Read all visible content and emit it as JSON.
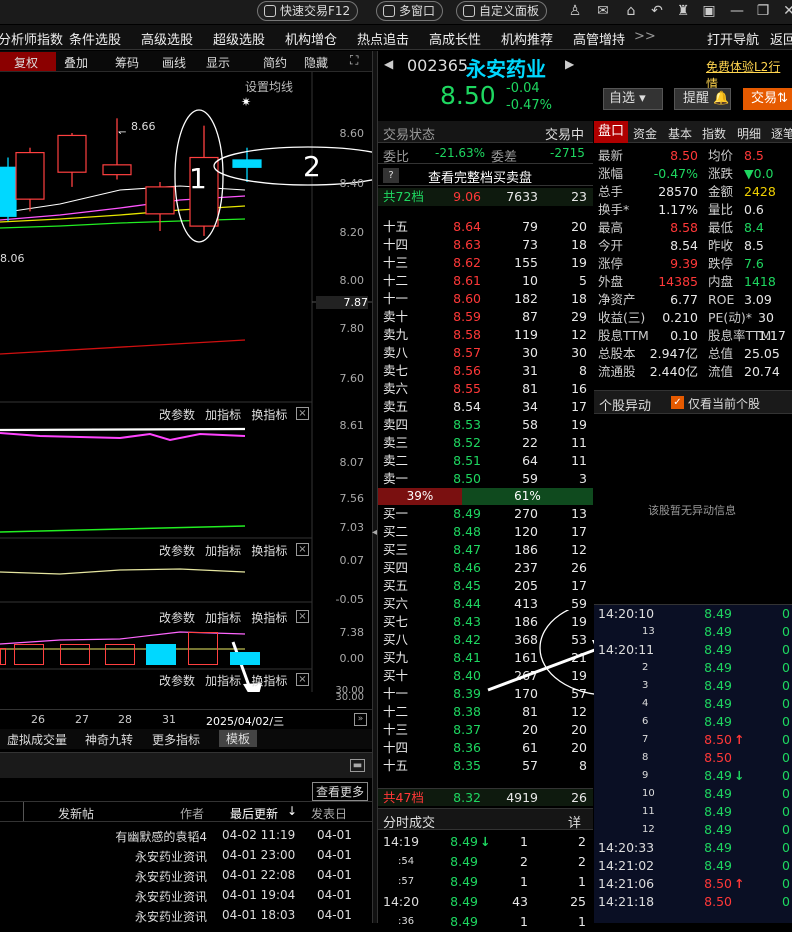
{
  "topbar": {
    "quick_trade": "快速交易F12",
    "multi_window": "多窗口",
    "custom_panel": "自定义面板"
  },
  "menu": {
    "items": [
      "分析师指数",
      "条件选股",
      "高级选股",
      "超级选股",
      "机构增仓",
      "热点追击",
      "高成长性",
      "机构推荐",
      "高管增持"
    ],
    "more": ">>",
    "open_nav": "打开导航",
    "back": "返回"
  },
  "chart_toolbar": {
    "items": [
      "复权",
      "叠加",
      "筹码",
      "画线",
      "显示",
      "简约",
      "隐藏"
    ],
    "ma_setting": "设置均线"
  },
  "kline": {
    "price_axis": [
      "8.60",
      "8.40",
      "8.20",
      "8.00",
      "7.87",
      "7.80",
      "7.60"
    ],
    "high_label": "8.66",
    "low_label": "8.06",
    "annot_1": "1",
    "annot_2": "2",
    "candles": [
      {
        "o": 8.46,
        "c": 8.26,
        "h": 8.5,
        "l": 8.24
      },
      {
        "o": 8.33,
        "c": 8.52,
        "h": 8.54,
        "l": 8.28
      },
      {
        "o": 8.44,
        "c": 8.59,
        "h": 8.6,
        "l": 8.38
      },
      {
        "o": 8.43,
        "c": 8.47,
        "h": 8.66,
        "l": 8.41
      },
      {
        "o": 8.27,
        "c": 8.38,
        "h": 8.4,
        "l": 8.2
      },
      {
        "o": 8.22,
        "c": 8.5,
        "h": 8.63,
        "l": 8.18
      },
      {
        "o": 8.49,
        "c": 8.46,
        "h": 8.54,
        "l": 8.4
      }
    ],
    "price_scale": {
      "top": 8.6,
      "bottom": 7.6
    }
  },
  "indicator1": {
    "controls": [
      "改参数",
      "加指标",
      "换指标"
    ],
    "axis": [
      "8.61",
      "8.07",
      "7.56",
      "7.03"
    ]
  },
  "indicator2": {
    "controls": [
      "改参数",
      "加指标",
      "换指标"
    ],
    "axis": [
      "0.07",
      "-0.05"
    ]
  },
  "indicator3": {
    "controls": [
      "改参数",
      "加指标",
      "换指标"
    ],
    "axis": [
      "7.38",
      "0.00"
    ]
  },
  "indicator4": {
    "controls": [
      "改参数",
      "加指标",
      "换指标"
    ],
    "axis": [
      "30.00",
      "30.00"
    ]
  },
  "dates": [
    "26",
    "27",
    "28",
    "31"
  ],
  "current_date": "2025/04/02/三",
  "bottom_tabs": [
    "虚拟成交量",
    "神奇九转",
    "更多指标",
    "模板"
  ],
  "news": {
    "see_more": "查看更多",
    "headers": {
      "post": "发新帖",
      "author": "作者",
      "latest": "最后更新",
      "published": "发表日"
    },
    "rows": [
      {
        "author": "有幽默感的袁韬4",
        "time": "04-02 11:19",
        "pub": "04-01"
      },
      {
        "author": "永安药业资讯",
        "time": "04-01 23:00",
        "pub": "04-01"
      },
      {
        "author": "永安药业资讯",
        "time": "04-01 22:08",
        "pub": "04-01"
      },
      {
        "author": "永安药业资讯",
        "time": "04-01 19:04",
        "pub": "04-01"
      },
      {
        "author": "永安药业资讯",
        "time": "04-01 18:03",
        "pub": "04-01"
      }
    ]
  },
  "stock": {
    "code": "002365",
    "name": "永安药业",
    "price": "8.50",
    "change": "-0.04",
    "change_pct": "-0.47%",
    "free_l2": "免费体验L2行情",
    "watchlist": "自选",
    "remind": "提醒",
    "trade": "交易"
  },
  "orderbook": {
    "status_label": "交易状态",
    "status": "交易中",
    "wb_label": "委比",
    "wb": "-21.63%",
    "wc_label": "委差",
    "wc": "-2715",
    "full_link": "查看完整档买卖盘",
    "sell_total": {
      "label": "共72档",
      "price": "9.06",
      "vol": "7633",
      "n": "23"
    },
    "sells": [
      [
        "十五",
        "8.64",
        "79",
        "20"
      ],
      [
        "十四",
        "8.63",
        "73",
        "18"
      ],
      [
        "十三",
        "8.62",
        "155",
        "19"
      ],
      [
        "十二",
        "8.61",
        "10",
        "5"
      ],
      [
        "十一",
        "8.60",
        "182",
        "18"
      ],
      [
        "卖十",
        "8.59",
        "87",
        "29"
      ],
      [
        "卖九",
        "8.58",
        "119",
        "12"
      ],
      [
        "卖八",
        "8.57",
        "30",
        "30"
      ],
      [
        "卖七",
        "8.56",
        "31",
        "8"
      ],
      [
        "卖六",
        "8.55",
        "81",
        "16"
      ],
      [
        "卖五",
        "8.54",
        "34",
        "17"
      ],
      [
        "卖四",
        "8.53",
        "58",
        "19"
      ],
      [
        "卖三",
        "8.52",
        "22",
        "11"
      ],
      [
        "卖二",
        "8.51",
        "64",
        "11"
      ],
      [
        "卖一",
        "8.50",
        "59",
        "3"
      ]
    ],
    "ratio_sell": "39%",
    "ratio_buy": "61%",
    "buys": [
      [
        "买一",
        "8.49",
        "270",
        "13"
      ],
      [
        "买二",
        "8.48",
        "120",
        "17"
      ],
      [
        "买三",
        "8.47",
        "186",
        "12"
      ],
      [
        "买四",
        "8.46",
        "237",
        "26"
      ],
      [
        "买五",
        "8.45",
        "205",
        "17"
      ],
      [
        "买六",
        "8.44",
        "413",
        "59"
      ],
      [
        "买七",
        "8.43",
        "186",
        "19"
      ],
      [
        "买八",
        "8.42",
        "368",
        "53"
      ],
      [
        "买九",
        "8.41",
        "161",
        "21"
      ],
      [
        "买十",
        "8.40",
        "267",
        "19"
      ],
      [
        "十一",
        "8.39",
        "170",
        "57"
      ],
      [
        "十二",
        "8.38",
        "81",
        "12"
      ],
      [
        "十三",
        "8.37",
        "20",
        "20"
      ],
      [
        "十四",
        "8.36",
        "61",
        "20"
      ],
      [
        "十五",
        "8.35",
        "57",
        "8"
      ]
    ],
    "buy_total": {
      "label": "共47档",
      "price": "8.32",
      "vol": "4919",
      "n": "26"
    }
  },
  "timesales": {
    "title": "分时成交",
    "detail": "详",
    "rows": [
      [
        "14:19",
        "8.49",
        "↓",
        "1",
        "2"
      ],
      [
        ":54",
        "8.49",
        "",
        "2",
        "2"
      ],
      [
        ":57",
        "8.49",
        "",
        "1",
        "1"
      ],
      [
        "14:20",
        "8.49",
        "",
        "43",
        "25"
      ],
      [
        ":36",
        "8.49",
        "",
        "1",
        "1"
      ]
    ]
  },
  "quote_tabs": [
    "盘口",
    "资金",
    "基本",
    "指数",
    "明细",
    "逐笔"
  ],
  "quote": {
    "rows": [
      [
        [
          "最新",
          "8.50",
          "red"
        ],
        [
          "均价",
          "8.5",
          "red"
        ]
      ],
      [
        [
          "涨幅",
          "-0.47%",
          "green"
        ],
        [
          "涨跌",
          "▼0.0",
          "green"
        ]
      ],
      [
        [
          "总手",
          "28570",
          "white"
        ],
        [
          "金额",
          "2428",
          "yellow"
        ]
      ],
      [
        [
          "换手*",
          "1.17%",
          "white"
        ],
        [
          "量比",
          "0.6",
          "white"
        ]
      ],
      [
        [
          "最高",
          "8.58",
          "red"
        ],
        [
          "最低",
          "8.4",
          "green"
        ]
      ],
      [
        [
          "今开",
          "8.54",
          "white"
        ],
        [
          "昨收",
          "8.5",
          "white"
        ]
      ],
      [
        [
          "涨停",
          "9.39",
          "red"
        ],
        [
          "跌停",
          "7.6",
          "green"
        ]
      ],
      [
        [
          "外盘",
          "14385",
          "red"
        ],
        [
          "内盘",
          "1418",
          "green"
        ]
      ],
      [
        [
          "净资产",
          "6.77",
          "white"
        ],
        [
          "ROE",
          "3.09",
          "white"
        ]
      ],
      [
        [
          "收益(三)",
          "0.210",
          "white"
        ],
        [
          "PE(动)*",
          "30",
          "white"
        ]
      ],
      [
        [
          "股息TTM",
          "0.10",
          "white"
        ],
        [
          "股息率TTM",
          "1.17",
          "white"
        ]
      ],
      [
        [
          "总股本",
          "2.947亿",
          "white"
        ],
        [
          "总值",
          "25.05",
          "white"
        ]
      ],
      [
        [
          "流通股",
          "2.440亿",
          "white"
        ],
        [
          "流值",
          "20.74",
          "white"
        ]
      ]
    ]
  },
  "anomaly": {
    "title": "个股异动",
    "checkbox": "仅看当前个股",
    "empty": "该股暂无异动信息"
  },
  "ticks": [
    [
      "14:20:10",
      "8.49",
      ""
    ],
    [
      "13",
      "8.49",
      ""
    ],
    [
      "14:20:11",
      "8.49",
      ""
    ],
    [
      "2",
      "8.49",
      ""
    ],
    [
      "3",
      "8.49",
      ""
    ],
    [
      "4",
      "8.49",
      ""
    ],
    [
      "6",
      "8.49",
      ""
    ],
    [
      "7",
      "8.50",
      "↑"
    ],
    [
      "8",
      "8.50",
      ""
    ],
    [
      "9",
      "8.49",
      "↓"
    ],
    [
      "10",
      "8.49",
      ""
    ],
    [
      "11",
      "8.49",
      ""
    ],
    [
      "12",
      "8.49",
      ""
    ],
    [
      "14:20:33",
      "8.49",
      ""
    ],
    [
      "14:21:02",
      "8.49",
      ""
    ],
    [
      "14:21:06",
      "8.50",
      "↑"
    ],
    [
      "14:21:18",
      "8.50",
      ""
    ]
  ],
  "colors": {
    "up": "#ff3838",
    "down": "#1ed760",
    "accent": "#00d8ff",
    "tabbar": "#b00000"
  }
}
